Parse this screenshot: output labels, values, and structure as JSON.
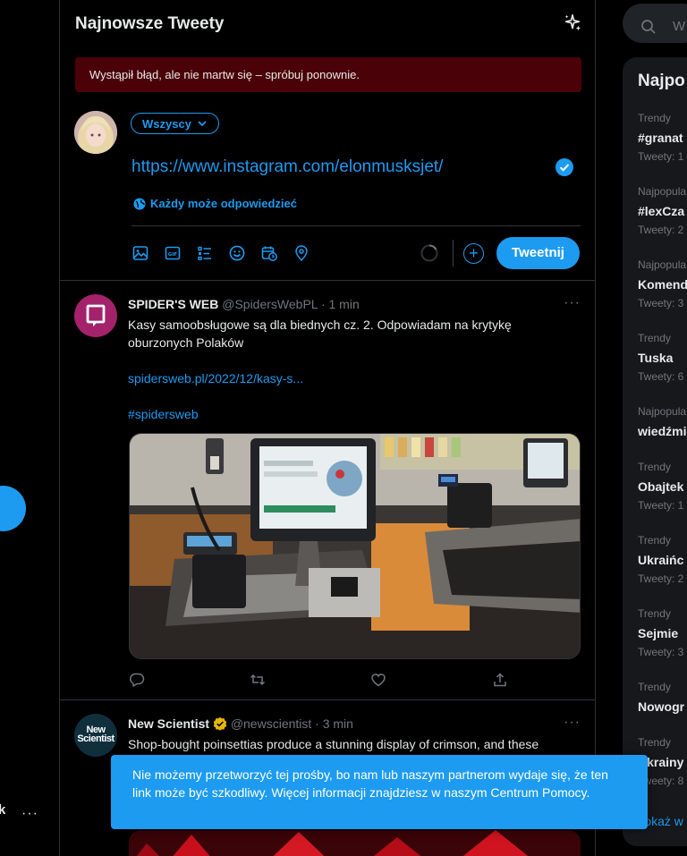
{
  "colors": {
    "accent": "#1d9bf0",
    "background": "#000000",
    "error_bg": "#4a0208",
    "muted": "#71767b"
  },
  "nav": {
    "partial_label": "k",
    "more_label": "···"
  },
  "header": {
    "title": "Najnowsze Tweety",
    "icon": "sparkle-icon"
  },
  "error_banner": {
    "text": "Wystąpił błąd, ale nie martw się – spróbuj ponownie."
  },
  "composer": {
    "audience_label": "Wszyscy",
    "text": "https://www.instagram.com/elonmusksjet/",
    "reply_setting": "Każdy może odpowiedzieć",
    "tweet_button": "Tweetnij",
    "add_label": "+",
    "tools": [
      "image-icon",
      "gif-icon",
      "poll-icon",
      "emoji-icon",
      "schedule-icon",
      "location-icon"
    ]
  },
  "tweets": [
    {
      "name": "SPIDER'S WEB",
      "handle": "@SpidersWebPL",
      "time": "· 1 min",
      "text": "Kasy samoobsługowe są dla biednych cz. 2. Odpowiadam na krytykę oburzonych Polaków",
      "link": "spidersweb.pl/2022/12/kasy-s...",
      "hashtag": "#spidersweb",
      "more": "···"
    },
    {
      "name": "New Scientist",
      "handle": "@newscientist",
      "time": "· 3 min",
      "text": "Shop-bought poinsettias produce a stunning display of crimson, and these",
      "avatar_text_1": "New",
      "avatar_text_2": "Scientist",
      "more": "···"
    }
  ],
  "sidebar": {
    "search_placeholder": "W",
    "trends_title": "Najpo",
    "trends": [
      {
        "context": "Trendy",
        "name": "#granat",
        "count": "Tweety: 1"
      },
      {
        "context": "Najpopula",
        "name": "#lexCza",
        "count": "Tweety: 2"
      },
      {
        "context": "Najpopula",
        "name": "Komend",
        "count": "Tweety: 3"
      },
      {
        "context": "Trendy",
        "name": "Tuska",
        "count": "Tweety: 6"
      },
      {
        "context": "Najpopula",
        "name": "wiedźmi",
        "count": ""
      },
      {
        "context": "Trendy",
        "name": "Obajtek",
        "count": "Tweety: 1"
      },
      {
        "context": "Trendy",
        "name": "Ukraińc",
        "count": "Tweety: 2"
      },
      {
        "context": "Trendy",
        "name": "Sejmie",
        "count": "Tweety: 3"
      },
      {
        "context": "Trendy",
        "name": "Nowogr",
        "count": ""
      },
      {
        "context": "Trendy",
        "name": "Ukrainy",
        "count": "Tweety: 8"
      }
    ],
    "show_more": "Pokaż w"
  },
  "toast": {
    "text": "Nie możemy przetworzyć tej prośby, bo nam lub naszym partnerom wydaje się, że ten link może być szkodliwy. Więcej informacji znajdziesz w naszym Centrum Pomocy."
  }
}
